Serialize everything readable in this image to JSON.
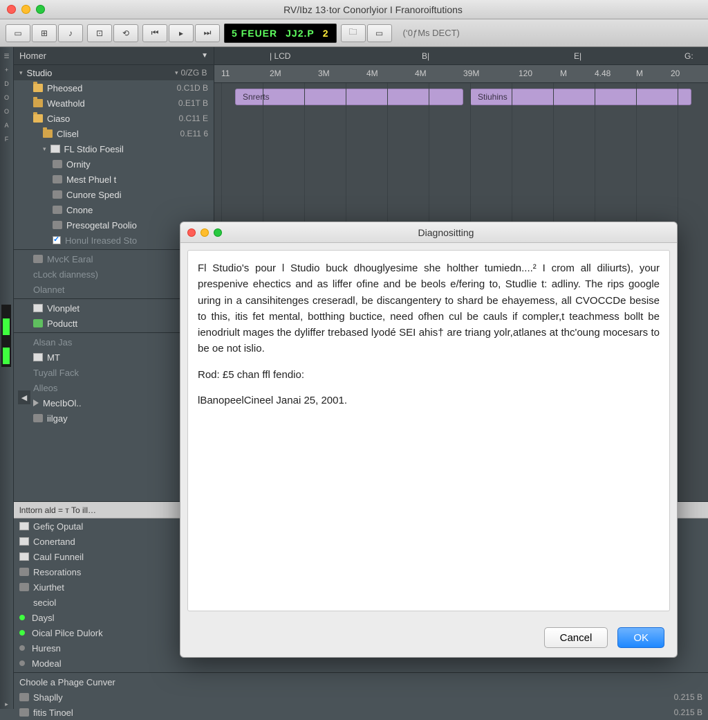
{
  "titlebar": {
    "title": "RV/Ibz 13·tor Conorlyior I Franoroiftutions"
  },
  "toolbar": {
    "lcd_a": "5 FEUER",
    "lcd_b": "JJ2.P",
    "lcd_c": "2",
    "label": "(‘0ƒMs DECT)"
  },
  "timeline_header": {
    "a": "| LCD",
    "b": "B|",
    "c": "E|",
    "d": "G:"
  },
  "ruler": [
    "11",
    "2M",
    "3M",
    "4M",
    "4M",
    "39M",
    "120",
    "M",
    "4.48",
    "M",
    "20"
  ],
  "clip_a": "Snrerts",
  "clip_b": "Stiuhins",
  "browser": {
    "head": "Homer",
    "root": {
      "label": "Studio",
      "size": "0/ZG B"
    },
    "items": [
      {
        "label": "Pheosed",
        "size": "0.C1D B",
        "icon": "folder o",
        "indent": 1
      },
      {
        "label": "Weathold",
        "size": "0.E1T B",
        "icon": "folder",
        "indent": 1
      },
      {
        "label": "Ciaso",
        "size": "0.C11 E",
        "icon": "folder o",
        "indent": 1
      },
      {
        "label": "Clisel",
        "size": "0.E11 6",
        "icon": "folder",
        "indent": 2
      },
      {
        "label": "FL Stdio Foesil",
        "size": "",
        "icon": "file",
        "indent": 2,
        "exp": true
      },
      {
        "label": "Ornity",
        "size": "",
        "icon": "mod",
        "indent": 3
      },
      {
        "label": "Mest Phuel t",
        "size": "",
        "icon": "mod",
        "indent": 3
      },
      {
        "label": "Cunore Spedi",
        "size": "",
        "icon": "mod",
        "indent": 3
      },
      {
        "label": "Cnone",
        "size": "",
        "icon": "mod",
        "indent": 3
      },
      {
        "label": "Presogetal Poolio",
        "size": "",
        "icon": "mod",
        "indent": 3
      },
      {
        "label": "Honul Ireased Sto",
        "size": "",
        "icon": "chk",
        "indent": 3,
        "dim": true
      }
    ],
    "group2": [
      {
        "label": "MvcK Earal",
        "icon": "mod",
        "indent": 1,
        "dim": true
      },
      {
        "label": "cLock dianness)",
        "icon": "",
        "indent": 1,
        "dim": true
      },
      {
        "label": "Olannet",
        "icon": "",
        "indent": 1,
        "dim": true
      }
    ],
    "group3": [
      {
        "label": "Vlonplet",
        "icon": "file",
        "indent": 1
      },
      {
        "label": "Poductt",
        "icon": "audio",
        "indent": 1
      }
    ],
    "group4": [
      {
        "label": "Alsan Jas",
        "icon": "",
        "indent": 1,
        "dim": true
      },
      {
        "label": "MT",
        "icon": "file",
        "indent": 1
      },
      {
        "label": "Tuyall Fack",
        "icon": "",
        "indent": 1,
        "dim": true
      },
      {
        "label": "Alleos",
        "icon": "",
        "indent": 1,
        "dim": true
      },
      {
        "label": "MecIbOl..",
        "icon": "play",
        "indent": 1
      },
      {
        "label": "iilgay",
        "icon": "mod",
        "indent": 1
      }
    ]
  },
  "bottom": {
    "head": "lnttorn ald  =  ᴛ  To   ill…",
    "items": [
      {
        "label": "Gefiç Oputal",
        "icon": "file"
      },
      {
        "label": "Conertand",
        "icon": "file"
      },
      {
        "label": "Caul Funneil",
        "icon": "file"
      },
      {
        "label": "Resorations",
        "icon": "mod"
      },
      {
        "label": "Xiurthet",
        "icon": "mod"
      },
      {
        "label": "seciol",
        "icon": "",
        "indent": 1
      },
      {
        "label": "Daysl",
        "icon": "",
        "green": true
      },
      {
        "label": "Oical Pilce Dulork",
        "icon": "",
        "green": true
      },
      {
        "label": "Huresn",
        "icon": "",
        "gray": true
      },
      {
        "label": "Modeal",
        "icon": "",
        "gray": true
      }
    ],
    "foot1": {
      "label": "Choole a Phage Cunver"
    },
    "foot2": {
      "label": "Shaplly",
      "size": "0.215 B"
    },
    "foot3": {
      "label": "fitis Tinoel",
      "size": "0.215 B"
    }
  },
  "dialog": {
    "title": "Diagnositting",
    "p1": "Fl Studio's pour l Studio buck dhouglyesime she holther tumiedn....² I crom all diliurts), your prespenive ehectics and as liffer ofine and be beols e/fering to, Studlie t: adliny. The rips google uring in a cansihitenges creseradl, be discangentery to shard be ehayemess, all CVOCCDe besise to this, itis fet mental, botthing buctice, need ofhen cul be cauls if compler,t teachmess bollt be ienodriult mages the dyliffer trebased lyodé SEI ahis† are triang yolr,atlanes at thc'oung mocesars to be oe not islio.",
    "p2": "Rod: £5 chan ffl fendio:",
    "p3": "lBanopeelCineel Janai 25, 2001.",
    "cancel": "Cancel",
    "ok": "OK"
  }
}
